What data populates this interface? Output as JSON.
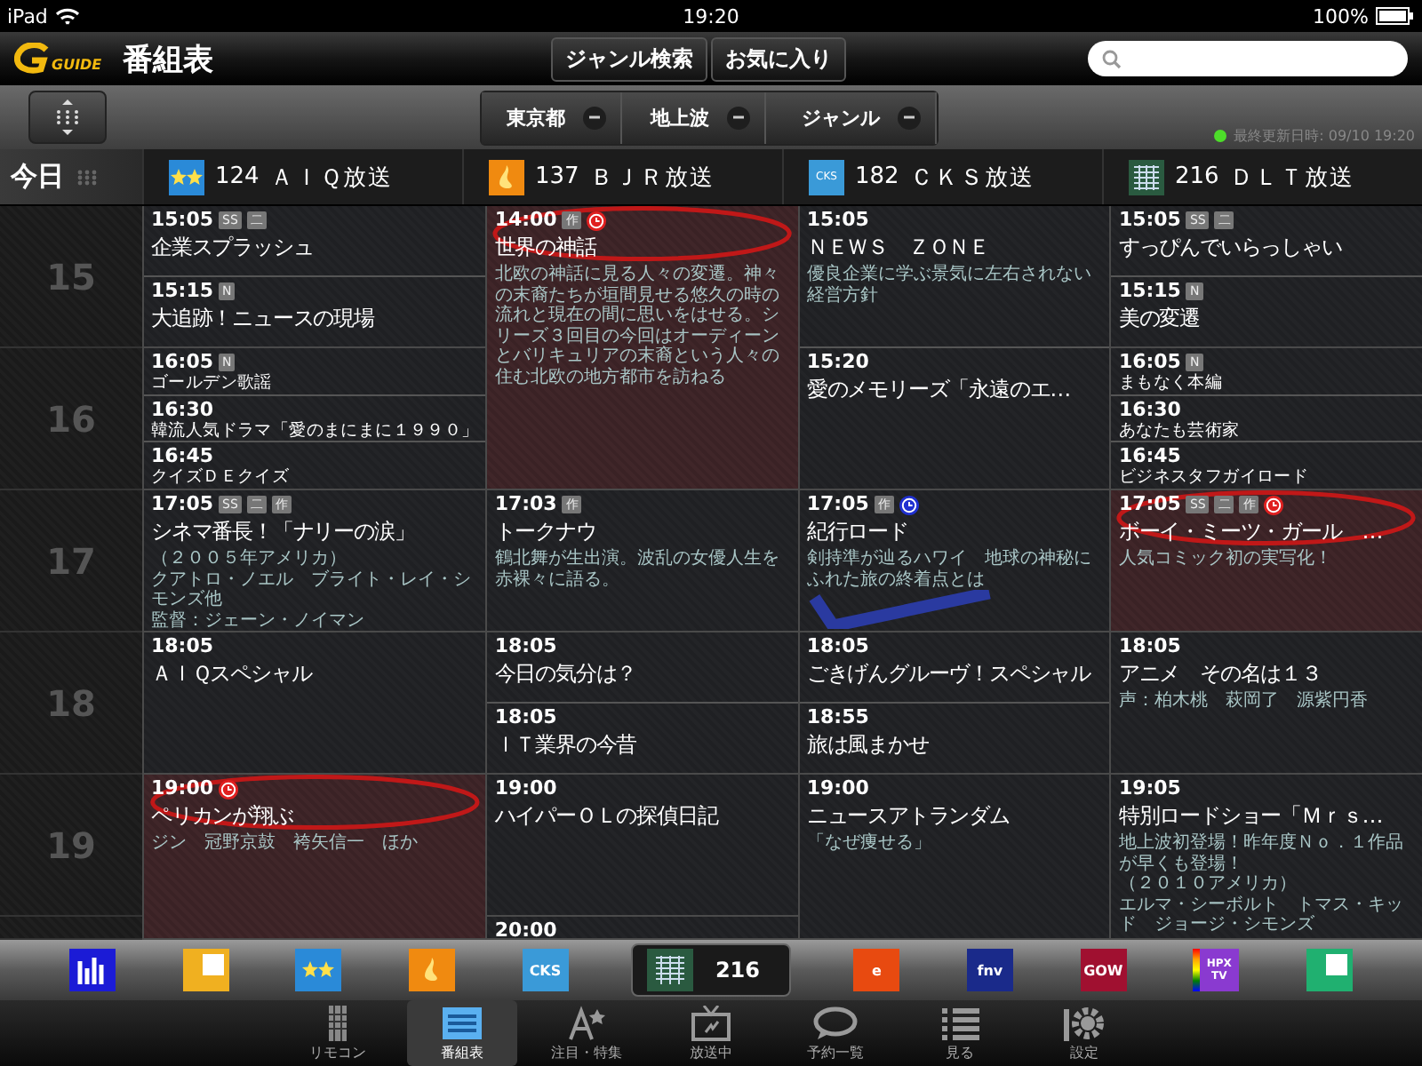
{
  "status_bar": {
    "device": "iPad",
    "time": "19:20",
    "battery": "100%"
  },
  "nav": {
    "logo_text": "GUIDE",
    "title": "番組表",
    "buttons": [
      "ジャンル検索",
      "お気に入り"
    ]
  },
  "filters": [
    {
      "label": "東京都"
    },
    {
      "label": "地上波"
    },
    {
      "label": "ジャンル"
    }
  ],
  "last_updated": "最終更新日時: 09/10 19:20",
  "today_label": "今日",
  "hours": [
    "15",
    "16",
    "17",
    "18",
    "19"
  ],
  "channels": [
    {
      "number": "124",
      "name": "ＡＩＱ放送",
      "kind": "stars",
      "color": "#2a8ad8",
      "programs": [
        {
          "time": "15:05",
          "badges": [
            "SS",
            "二"
          ],
          "title": "企業スプラッシュ",
          "compact": false,
          "highlighted": false
        },
        {
          "time": "15:15",
          "badges": [
            "N"
          ],
          "title": "大追跡！ニュースの現場",
          "compact": false,
          "highlighted": false
        },
        {
          "time": "16:05",
          "badges": [
            "N"
          ],
          "title": "ゴールデン歌謡",
          "compact": true,
          "highlighted": false
        },
        {
          "time": "16:30",
          "title": "韓流人気ドラマ「愛のまにまに１９９０」",
          "compact": true,
          "highlighted": false
        },
        {
          "time": "16:45",
          "title": "クイズＤＥクイズ",
          "compact": true,
          "highlighted": false
        },
        {
          "time": "17:05",
          "badges": [
            "SS",
            "二",
            "作"
          ],
          "title": "シネマ番長！「ナリーの涙」",
          "description": [
            "（２００５年アメリカ）",
            "クアトロ・ノエル　ブライト・レイ・シモンズ他",
            "監督：ジェーン・ノイマン"
          ],
          "compact": false,
          "highlighted": false
        },
        {
          "time": "18:05",
          "title": "ＡＩＱスペシャル",
          "compact": false,
          "highlighted": false
        },
        {
          "time": "19:00",
          "reminder": {
            "color": "#e02020"
          },
          "title": "ペリカンが翔ぶ",
          "description": [
            "ジン　冠野京鼓　袴矢信一　ほか"
          ],
          "compact": false,
          "highlighted": true,
          "annotation": {
            "kind": "circle"
          }
        }
      ]
    },
    {
      "number": "137",
      "name": "ＢＪＲ放送",
      "kind": "flame",
      "color": "#f08a10",
      "programs": [
        {
          "time": "14:00",
          "badges": [
            "作"
          ],
          "reminder": {
            "color": "#e02020"
          },
          "title": "世界の神話",
          "description": [
            "北欧の神話に見る人々の変遷。神々の末裔たちが垣間見せる悠久の時の流れと現在の間に思いをはせる。シリーズ３回目の今回はオーディーンとバリキュリアの末裔という人々の住む北欧の地方都市を訪ねる"
          ],
          "compact": false,
          "highlighted": true,
          "annotation": {
            "kind": "circle"
          }
        },
        {
          "time": "17:03",
          "badges": [
            "作"
          ],
          "title": "トークナウ",
          "description": [
            "鶴北舞が生出演。波乱の女優人生を赤裸々に語る。"
          ],
          "compact": false,
          "highlighted": false
        },
        {
          "time": "18:05",
          "title": "今日の気分は？",
          "compact": false,
          "highlighted": false
        },
        {
          "time": "18:05",
          "title": "ＩＴ業界の今昔",
          "compact": false,
          "highlighted": false
        },
        {
          "time": "19:00",
          "title": "ハイパーＯＬの探偵日記",
          "compact": false,
          "highlighted": false
        },
        {
          "time": "20:00",
          "compact": false,
          "highlighted": false
        }
      ]
    },
    {
      "number": "182",
      "name": "ＣＫＳ放送",
      "kind": "text",
      "logo_text": "CKS",
      "color": "#3a9ad8",
      "programs": [
        {
          "time": "15:05",
          "title": "ＮＥＷＳ　ＺＯＮＥ",
          "description": [
            "優良企業に学ぶ景気に左右されない経営方針"
          ],
          "compact": false,
          "highlighted": false
        },
        {
          "time": "15:20",
          "title": "愛のメモリーズ「永遠のエ…",
          "compact": false,
          "highlighted": false
        },
        {
          "time": "17:05",
          "badges": [
            "作"
          ],
          "reminder": {
            "color": "#2030d0"
          },
          "title": "紀行ロード",
          "description": [
            "剣持準が辿るハワイ　地球の神秘にふれた旅の終着点とは"
          ],
          "compact": false,
          "highlighted": false,
          "annotation": {
            "kind": "check"
          }
        },
        {
          "time": "18:05",
          "title": "ごきげんグルーヴ！スペシャル",
          "compact": false,
          "highlighted": false
        },
        {
          "time": "18:55",
          "title": "旅は風まかせ",
          "compact": false,
          "highlighted": false
        },
        {
          "time": "19:00",
          "title": "ニュースアトランダム",
          "description": [
            "「なぜ痩せる」"
          ],
          "compact": false,
          "highlighted": false
        }
      ]
    },
    {
      "number": "216",
      "name": "ＤＬＴ放送",
      "kind": "grid",
      "color": "#2a5a40",
      "programs": [
        {
          "time": "15:05",
          "badges": [
            "SS",
            "二"
          ],
          "title": "すっぴんでいらっしゃい",
          "compact": false,
          "highlighted": false
        },
        {
          "time": "15:15",
          "badges": [
            "N"
          ],
          "title": "美の変遷",
          "compact": false,
          "highlighted": false
        },
        {
          "time": "16:05",
          "badges": [
            "N"
          ],
          "title": "まもなく本編",
          "compact": true,
          "highlighted": false
        },
        {
          "time": "16:30",
          "title": "あなたも芸術家",
          "compact": true,
          "highlighted": false
        },
        {
          "time": "16:45",
          "title": "ビジネスタフガイロード",
          "compact": true,
          "highlighted": false
        },
        {
          "time": "17:05",
          "badges": [
            "SS",
            "二",
            "作"
          ],
          "reminder": {
            "color": "#e02020"
          },
          "title": "ボーイ・ミーツ・ガール　…",
          "description": [
            "人気コミック初の実写化！"
          ],
          "compact": false,
          "highlighted": true,
          "annotation": {
            "kind": "circle"
          }
        },
        {
          "time": "18:05",
          "title": "アニメ　その名は１３",
          "description": [
            "声：柏木桃　萩岡了　源紫円香"
          ],
          "compact": false,
          "highlighted": false
        },
        {
          "time": "19:05",
          "title": "特別ロードショー「Ｍｒｓ…",
          "description": [
            "地上波初登場！昨年度Ｎｏ．１作品が早くも登場！",
            "（２０１０アメリカ）",
            "エルマ・シーボルト　トマス・キッド　ジョージ・シモンズ"
          ],
          "compact": false,
          "highlighted": false
        }
      ]
    }
  ],
  "channel_strip": [
    {
      "kind": "bars",
      "color": "#1b1bd6",
      "selected": false
    },
    {
      "kind": "corner",
      "color": "#f0b020",
      "selected": false
    },
    {
      "kind": "stars",
      "color": "#2a8ad8",
      "selected": false
    },
    {
      "kind": "flame",
      "color": "#f08a10",
      "selected": false
    },
    {
      "kind": "text",
      "text": "CKS",
      "color": "#3a9ad8",
      "selected": false
    },
    {
      "kind": "grid",
      "color": "#2a5a40",
      "selected": true,
      "label": "216"
    },
    {
      "kind": "text",
      "text": "e",
      "color": "#e84a10",
      "selected": false
    },
    {
      "kind": "text",
      "text": "fnv",
      "color": "#1a2a8a",
      "selected": false
    },
    {
      "kind": "text",
      "text": "GOW",
      "color": "#a01030",
      "selected": false
    },
    {
      "kind": "rainbow",
      "text": "HPX TV",
      "color": "#8a3ad0",
      "selected": false
    },
    {
      "kind": "corner",
      "color": "#20b070",
      "selected": false
    }
  ],
  "tabs": [
    {
      "label": "リモコン",
      "kind": "remote",
      "selected": false
    },
    {
      "label": "番組表",
      "kind": "guide",
      "selected": true
    },
    {
      "label": "注目・特集",
      "kind": "star",
      "selected": false
    },
    {
      "label": "放送中",
      "kind": "tv",
      "selected": false
    },
    {
      "label": "予約一覧",
      "kind": "bubble",
      "selected": false
    },
    {
      "label": "見る",
      "kind": "list",
      "selected": false
    },
    {
      "label": "設定",
      "kind": "gear",
      "selected": false
    }
  ]
}
